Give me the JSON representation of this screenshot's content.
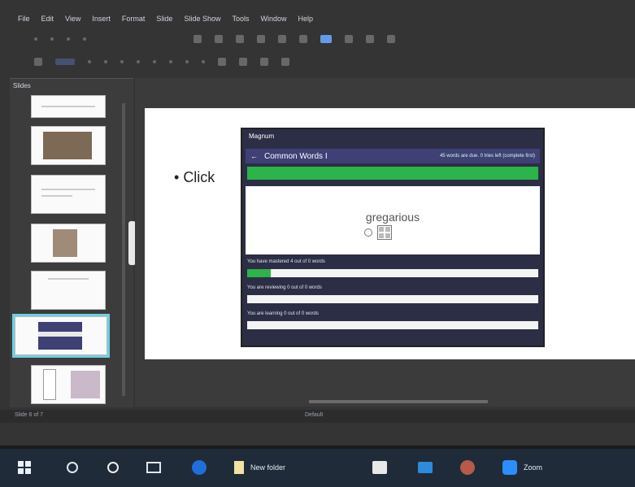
{
  "menubar": {
    "items": [
      "File",
      "Edit",
      "View",
      "Insert",
      "Format",
      "Slide",
      "Slide Show",
      "Tools",
      "Window",
      "Help"
    ]
  },
  "sidebar": {
    "title": "Slides"
  },
  "slide": {
    "bullet": "Click",
    "screenshot": {
      "title": "Magnum",
      "header": "Common Words I",
      "header_right": "45 words are due. 0 tries left (complete first)",
      "green_text": "",
      "word": "gregarious",
      "bars": [
        {
          "label": "You have mastered 4 out of 0 words",
          "progress": 0.08
        },
        {
          "label": "You are reviewing 0 out of 0 words",
          "progress": 0
        },
        {
          "label": "You are learning 0 out of 0 words",
          "progress": 0
        }
      ]
    }
  },
  "status": {
    "slide": "Slide 6 of 7",
    "layout": "Default",
    "zoom": ""
  },
  "taskbar": {
    "new_folder": "New folder",
    "zoom": "Zoom"
  },
  "colors": {
    "accent": "#2cb34a",
    "selection": "#6fd0e0",
    "header": "#3e4076"
  }
}
